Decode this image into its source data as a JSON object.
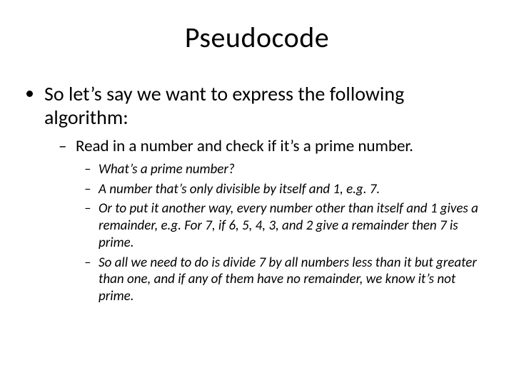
{
  "title": "Pseudocode",
  "bullet1": "So let’s say we want to express the following algorithm:",
  "sub1": "Read in a number and check if it’s a prime number.",
  "subsub": [
    "What’s a prime number?",
    "A number that’s only divisible by itself and 1, e.g. 7.",
    "Or to put it another way, every number other than itself and 1 gives a remainder, e.g. For 7, if 6, 5, 4, 3, and 2 give a remainder then 7 is prime.",
    "So all we need to do is divide 7 by all numbers less than it but greater than one, and if any of them have no remainder, we know it’s not prime."
  ]
}
